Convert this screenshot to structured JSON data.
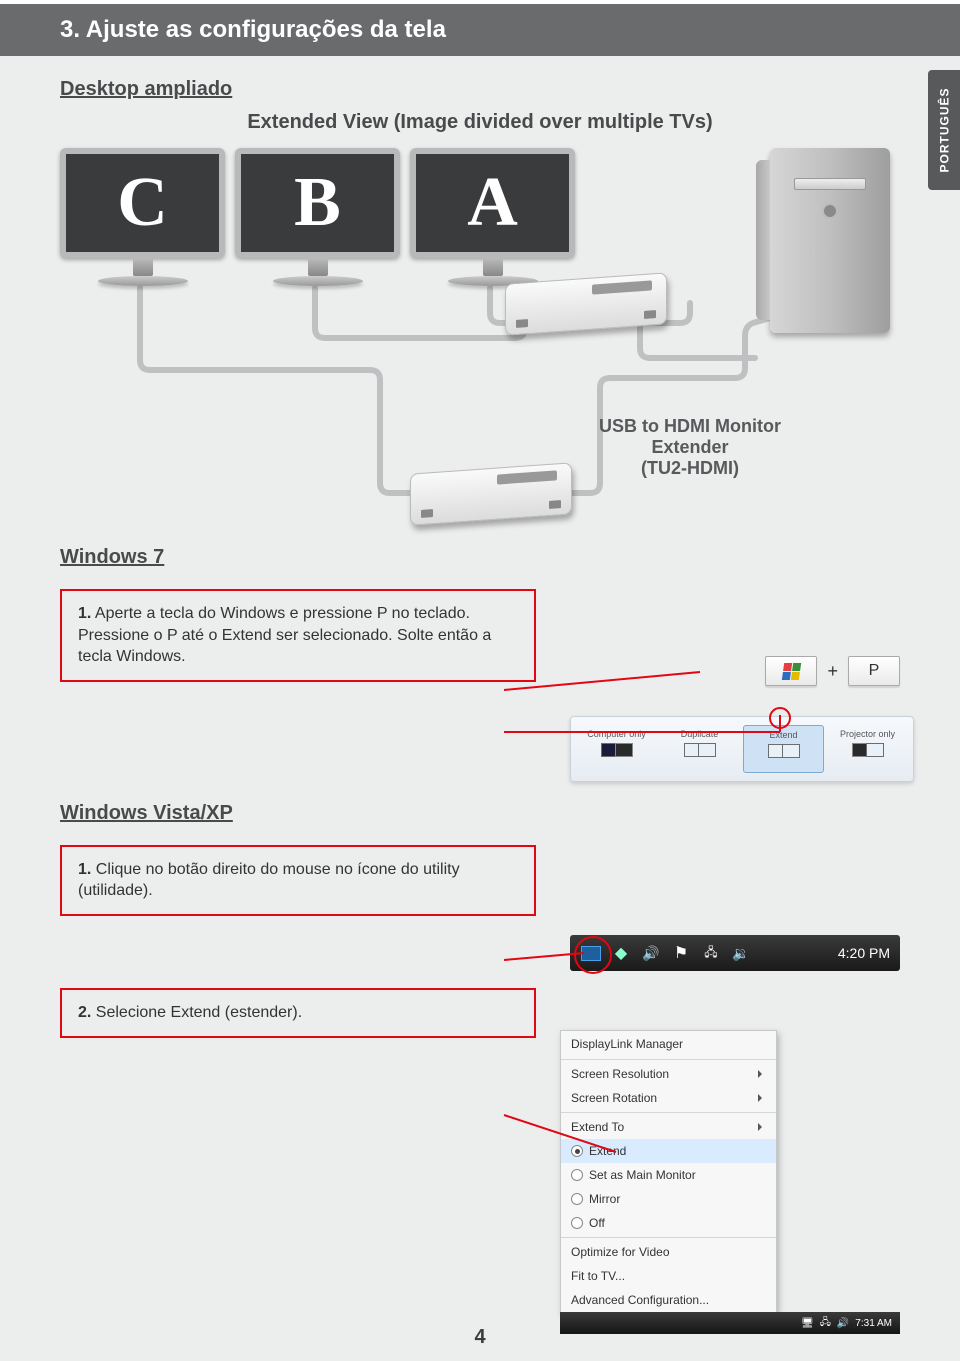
{
  "header": {
    "title": "3. Ajuste as configurações da tela"
  },
  "lang_tab": "PORTUGUÊS",
  "section": {
    "desktop_ampliado": "Desktop ampliado",
    "extended_view": "Extended View (Image divided over multiple TVs)"
  },
  "monitors": {
    "c": "C",
    "b": "B",
    "a": "A"
  },
  "extender": {
    "line1": "USB to HDMI Monitor Extender",
    "line2": "(TU2-HDMI)"
  },
  "win7": {
    "title": "Windows 7",
    "step1_num": "1.",
    "step1": "Aperte a tecla do Windows e pressione P no teclado. Pressione o P até o Extend ser selecionado. Solte então a tecla Windows.",
    "keys": {
      "plus": "+",
      "p": "P"
    },
    "proj": {
      "computer_only": "Computer only",
      "duplicate": "Duplicate",
      "extend": "Extend",
      "projector_only": "Projector only"
    }
  },
  "winvxp": {
    "title": "Windows Vista/XP",
    "step1_num": "1.",
    "step1": "Clique no botão direito do mouse no ícone do utility (utilidade).",
    "step2_num": "2.",
    "step2": "Selecione Extend (estender).",
    "taskbar_time": "4:20 PM",
    "mini_taskbar_time": "7:31 AM",
    "menu": {
      "title": "DisplayLink Manager",
      "screen_resolution": "Screen Resolution",
      "screen_rotation": "Screen Rotation",
      "extend_to": "Extend To",
      "extend": "Extend",
      "set_main": "Set as Main Monitor",
      "mirror": "Mirror",
      "off": "Off",
      "optimize": "Optimize for Video",
      "fit_tv": "Fit to TV...",
      "adv": "Advanced Configuration..."
    }
  },
  "page_num": "4"
}
